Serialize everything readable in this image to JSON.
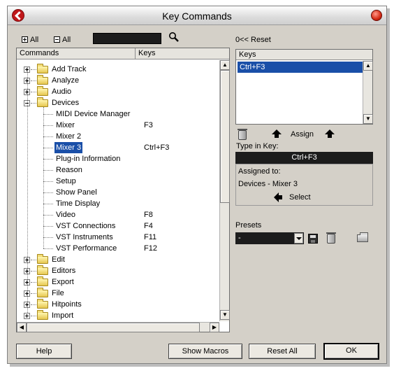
{
  "window": {
    "title": "Key Commands"
  },
  "toolbar": {
    "expand_all": "All",
    "collapse_all": "All",
    "search_value": ""
  },
  "commands_list": {
    "headers": {
      "commands": "Commands",
      "keys": "Keys"
    },
    "rows": [
      {
        "label": "Add Track",
        "key": "",
        "type": "folder",
        "state": "collapsed"
      },
      {
        "label": "Analyze",
        "key": "",
        "type": "folder",
        "state": "collapsed"
      },
      {
        "label": "Audio",
        "key": "",
        "type": "folder",
        "state": "collapsed"
      },
      {
        "label": "Devices",
        "key": "",
        "type": "folder",
        "state": "expanded"
      },
      {
        "label": "MIDI Device Manager",
        "key": "",
        "type": "command"
      },
      {
        "label": "Mixer",
        "key": "F3",
        "type": "command"
      },
      {
        "label": "Mixer 2",
        "key": "",
        "type": "command"
      },
      {
        "label": "Mixer 3",
        "key": "Ctrl+F3",
        "type": "command",
        "selected": true
      },
      {
        "label": "Plug-in Information",
        "key": "",
        "type": "command"
      },
      {
        "label": "Reason",
        "key": "",
        "type": "command"
      },
      {
        "label": "Setup",
        "key": "",
        "type": "command"
      },
      {
        "label": "Show Panel",
        "key": "",
        "type": "command"
      },
      {
        "label": "Time Display",
        "key": "",
        "type": "command"
      },
      {
        "label": "Video",
        "key": "F8",
        "type": "command"
      },
      {
        "label": "VST Connections",
        "key": "F4",
        "type": "command"
      },
      {
        "label": "VST Instruments",
        "key": "F11",
        "type": "command"
      },
      {
        "label": "VST Performance",
        "key": "F12",
        "type": "command"
      },
      {
        "label": "Edit",
        "key": "",
        "type": "folder",
        "state": "collapsed"
      },
      {
        "label": "Editors",
        "key": "",
        "type": "folder",
        "state": "collapsed"
      },
      {
        "label": "Export",
        "key": "",
        "type": "folder",
        "state": "collapsed"
      },
      {
        "label": "File",
        "key": "",
        "type": "folder",
        "state": "collapsed"
      },
      {
        "label": "Hitpoints",
        "key": "",
        "type": "folder",
        "state": "collapsed"
      },
      {
        "label": "Import",
        "key": "",
        "type": "folder",
        "state": "collapsed"
      }
    ]
  },
  "reset": {
    "label": "0<< Reset"
  },
  "keys_panel": {
    "header": "Keys",
    "items": [
      "Ctrl+F3"
    ]
  },
  "assign": {
    "label": "Assign"
  },
  "type_in": {
    "label": "Type in Key:",
    "value": "Ctrl+F3"
  },
  "assigned": {
    "label": "Assigned to:",
    "value": "Devices - Mixer 3"
  },
  "select": {
    "label": "Select"
  },
  "presets": {
    "label": "Presets",
    "value": "-"
  },
  "buttons": {
    "help": "Help",
    "show_macros": "Show Macros",
    "reset_all": "Reset All",
    "ok": "OK"
  }
}
